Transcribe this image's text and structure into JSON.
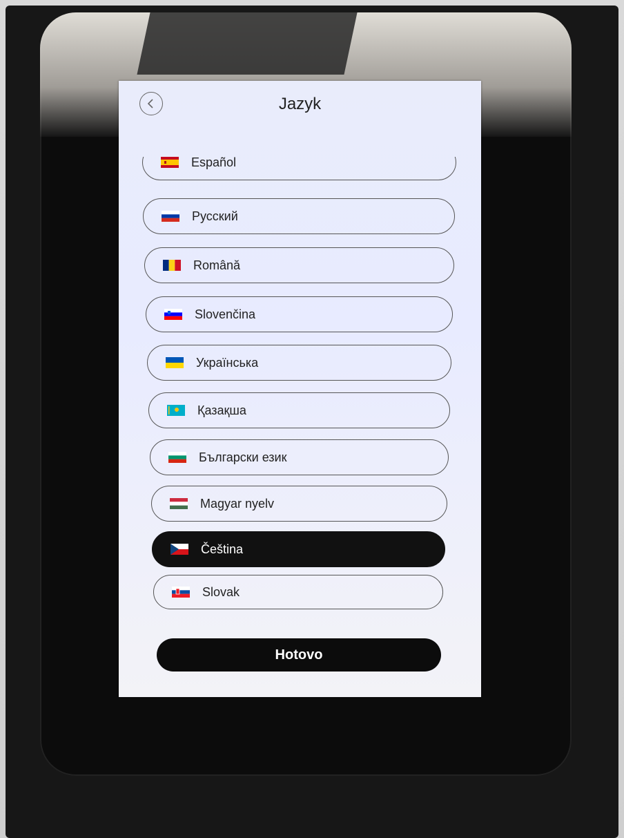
{
  "header": {
    "title": "Jazyk",
    "back_icon": "chevron-left-icon"
  },
  "languages": [
    {
      "label": "Español",
      "flag": "spain-flag-icon",
      "selected": false
    },
    {
      "label": "Русский",
      "flag": "russia-flag-icon",
      "selected": false
    },
    {
      "label": "Română",
      "flag": "romania-flag-icon",
      "selected": false
    },
    {
      "label": "Slovenčina",
      "flag": "slovenia-flag-icon",
      "selected": false
    },
    {
      "label": "Українська",
      "flag": "ukraine-flag-icon",
      "selected": false
    },
    {
      "label": "Қазақша",
      "flag": "kazakhstan-flag-icon",
      "selected": false
    },
    {
      "label": "Български език",
      "flag": "bulgaria-flag-icon",
      "selected": false
    },
    {
      "label": "Magyar nyelv",
      "flag": "hungary-flag-icon",
      "selected": false
    },
    {
      "label": "Čeština",
      "flag": "czech-flag-icon",
      "selected": true
    },
    {
      "label": "Slovak",
      "flag": "slovakia-flag-icon",
      "selected": false
    }
  ],
  "footer": {
    "done_label": "Hotovo"
  },
  "colors": {
    "selected_bg": "#111111",
    "screen_bg": "#e9ecfb",
    "button_bg": "#0c0c0c"
  }
}
